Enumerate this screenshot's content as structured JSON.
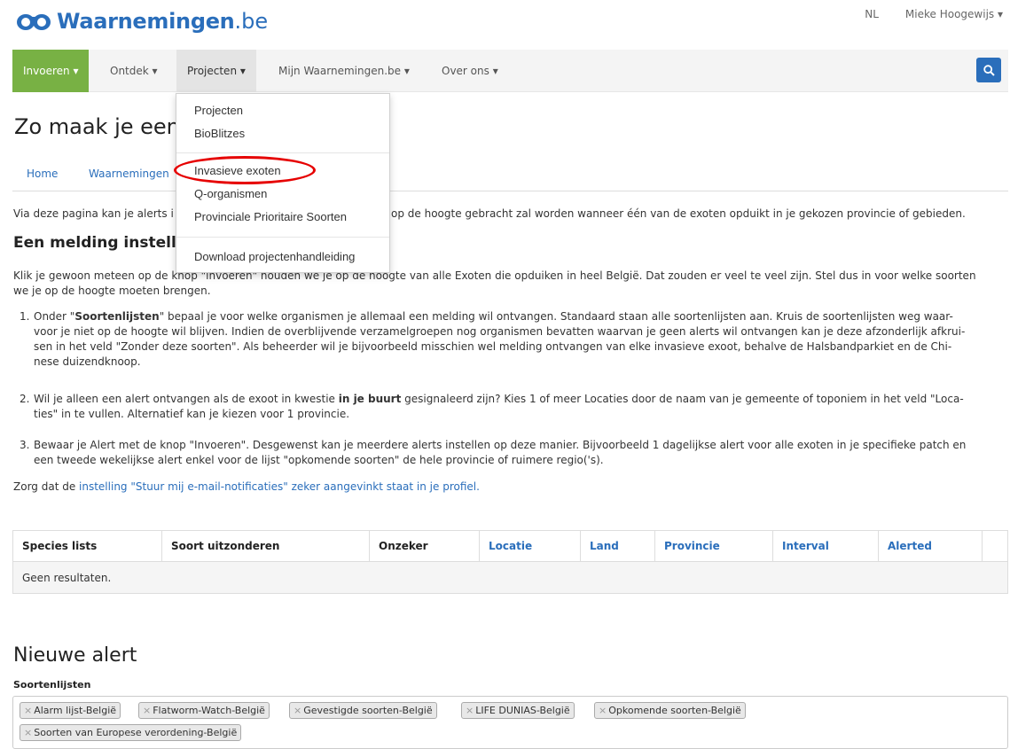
{
  "brand": {
    "name": "Waarnemingen",
    "tld": ".be"
  },
  "top_right": {
    "lang": "NL",
    "user": "Mieke Hoogewijs ▾"
  },
  "nav": [
    {
      "label": "Invoeren ▾"
    },
    {
      "label": "Ontdek ▾"
    },
    {
      "label": "Projecten ▾"
    },
    {
      "label": "Mijn Waarnemingen.be ▾"
    },
    {
      "label": "Over ons ▾"
    }
  ],
  "dropdown": {
    "items": [
      "Projecten",
      "BioBlitzes",
      "Invasieve exoten",
      "Q-organismen",
      "Provinciale Prioritaire Soorten",
      "Download projectenhandleiding"
    ]
  },
  "page_title": "Zo maak je een",
  "breadcrumb": [
    "Home",
    "Waarnemingen"
  ],
  "intro": {
    "left": "Via deze pagina kan je alerts i",
    "right": "op de hoogte gebracht zal worden wanneer één van de exoten opduikt in je gekozen provincie of gebieden."
  },
  "section_title": "Een melding instelle",
  "para1": {
    "line1_start": "Klik je gewoon meteen op de ",
    "line1_rest": "knop \"invoeren\" houden we je op de hoogte van alle Exoten die opduiken in heel België. Dat zouden er veel te veel zijn. Stel dus in voor welke soorten",
    "line2": "we je op de hoogte moeten brengen."
  },
  "steps": [
    {
      "num": "1.",
      "lines": [
        [
          "Onder \"",
          "Soortenlijsten",
          "\" bepaal je voor welke organismen je allemaal een melding wil ontvangen. Standaard staan alle soortenlijsten aan. Kruis de soortenlijsten weg waar-"
        ],
        "voor je niet op de hoogte wil blijven. Indien de overblijvende verzamelgroepen nog organismen bevatten waarvan je geen alerts wil ontvangen kan je deze afzonderlijk afkrui-",
        "sen in het veld \"Zonder deze soorten\". Als beheerder wil je bijvoorbeeld misschien wel melding ontvangen van elke invasieve exoot, behalve de Halsbandparkiet en de Chi-",
        "nese duizendknoop."
      ]
    },
    {
      "num": "2.",
      "lines": [
        [
          "Wil je alleen een alert ontvangen als de exoot in kwestie ",
          "in je buurt",
          " gesignaleerd zijn? Kies 1 of meer Locaties door de naam van je gemeente of toponiem in het veld \"Loca-"
        ],
        "ties\" in te vullen. Alternatief kan je kiezen voor 1 provincie."
      ]
    },
    {
      "num": "3.",
      "lines": [
        "Bewaar je Alert met de knop \"Invoeren\". Desgewenst kan je meerdere alerts instellen op deze manier. Bijvoorbeeld 1 dagelijkse alert voor alle exoten in je specifieke patch en",
        "een tweede wekelijkse alert enkel voor de lijst \"opkomende soorten\" de hele provincie of ruimere regio('s)."
      ]
    }
  ],
  "profile_note": {
    "prefix": "Zorg dat de ",
    "link": "instelling \"Stuur mij e-mail-notificaties\" zeker aangevinkt staat in je profiel."
  },
  "table": {
    "headers": [
      {
        "label": "Species lists",
        "link": false
      },
      {
        "label": "Soort uitzonderen",
        "link": false
      },
      {
        "label": "Onzeker",
        "link": false
      },
      {
        "label": "Locatie",
        "link": true
      },
      {
        "label": "Land",
        "link": true
      },
      {
        "label": "Provincie",
        "link": true
      },
      {
        "label": "Interval",
        "link": true
      },
      {
        "label": "Alerted",
        "link": true
      },
      {
        "label": "",
        "link": false
      }
    ],
    "empty": "Geen resultaten."
  },
  "new_alert": {
    "title": "Nieuwe alert",
    "field_label": "Soortenlijsten",
    "tags": [
      "Alarm lijst-België",
      "Flatworm-Watch-België",
      "Gevestigde soorten-België",
      "LIFE DUNIAS-België",
      "Opkomende soorten-België",
      "Soorten van Europese verordening-België"
    ]
  },
  "colors": {
    "brand_blue": "#2a6ebb",
    "nav_green": "#78b144",
    "highlight_red": "#e60000"
  },
  "icons": [
    "binoculars-logo-icon",
    "search-icon",
    "tag-remove-icon"
  ]
}
